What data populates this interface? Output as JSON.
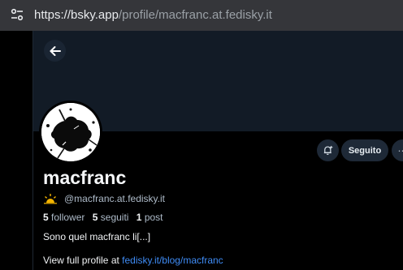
{
  "browser": {
    "url_host": "https://bsky.app",
    "url_path": "/profile/macfranc.at.fedisky.it"
  },
  "profile": {
    "display_name": "macfranc",
    "handle": "@macfranc.at.fedisky.it",
    "stats": {
      "followers_count": "5",
      "followers_label": "follower",
      "following_count": "5",
      "following_label": "seguiti",
      "posts_count": "1",
      "posts_label": "post"
    },
    "bio": "Sono quel macfranc li[...]",
    "full_profile_prefix": "View full profile at",
    "full_profile_link": "fedisky.it/blog/macfranc"
  },
  "actions": {
    "follow_label": "Seguito"
  },
  "colors": {
    "banner": "#121b26",
    "button_bg": "#1e2937",
    "link": "#3f8cf5",
    "muted_text": "#aebbc9"
  },
  "icons": {
    "url_bar": "site-settings-icon",
    "back": "arrow-left-icon",
    "notify": "bell-plus-icon",
    "more": "ellipsis-icon",
    "handle_badge": "sun-emoji-icon"
  }
}
